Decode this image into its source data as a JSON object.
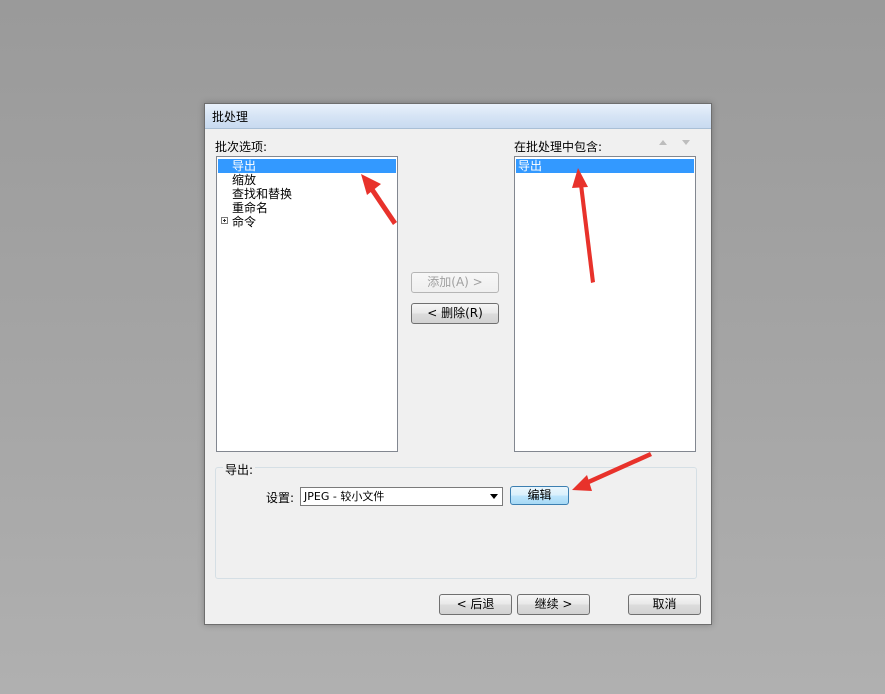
{
  "dialog": {
    "title": "批处理",
    "batch_options_label": "批次选项:",
    "included_label": "在批处理中包含:",
    "options": [
      {
        "label": "导出",
        "selected": true,
        "expandable": false
      },
      {
        "label": "缩放",
        "selected": false,
        "expandable": false
      },
      {
        "label": "查找和替换",
        "selected": false,
        "expandable": false
      },
      {
        "label": "重命名",
        "selected": false,
        "expandable": false
      },
      {
        "label": "命令",
        "selected": false,
        "expandable": true
      }
    ],
    "included": [
      {
        "label": "导出",
        "selected": true
      }
    ],
    "add_button": "添加(A) >",
    "remove_button": "< 删除(R)",
    "export_section": {
      "label": "导出:",
      "settings_label": "设置:",
      "settings_value": "JPEG - 较小文件",
      "edit_button": "编辑"
    },
    "back_button": "< 后退",
    "continue_button": "继续 >",
    "cancel_button": "取消"
  },
  "colors": {
    "selection": "#3399ff",
    "annotation_arrow": "#e8322b"
  }
}
